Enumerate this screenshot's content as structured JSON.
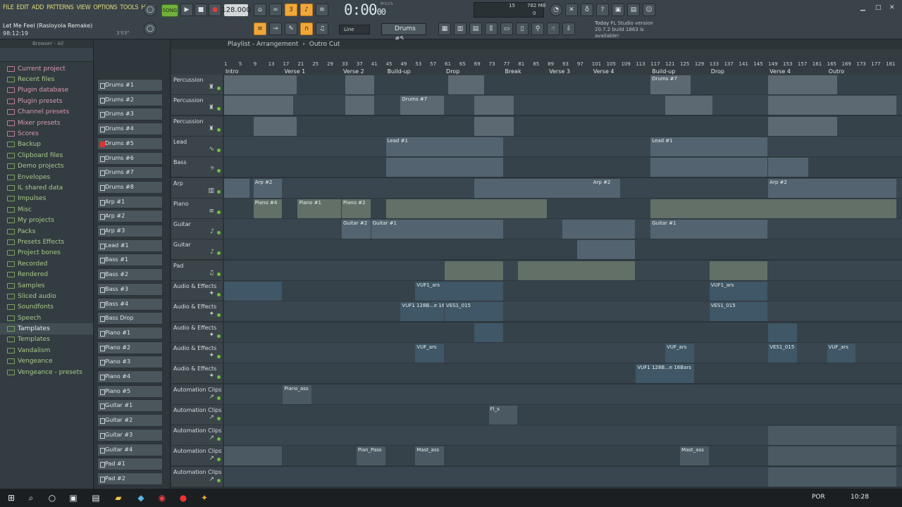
{
  "menu": [
    "FILE",
    "EDIT",
    "ADD",
    "PATTERNS",
    "VIEW",
    "OPTIONS",
    "TOOLS",
    "HELP"
  ],
  "project": {
    "title": "Let Me Feel (Rasloyola Remake)",
    "time": "98:12:19",
    "duration": "3'03\""
  },
  "transport": {
    "mode_label": "SONG",
    "tempo": "128.000",
    "time": "0:00",
    "time_sub": "00",
    "time_label": "M:S:CS"
  },
  "cpu": {
    "value": "15",
    "memory": "782 MB",
    "voices": "0"
  },
  "snap": "Line",
  "pattern": "Drums #5",
  "news": {
    "line1_label": "Today",
    "line1": "FL Studio version",
    "line2": "20.7.2 build 1863 is available!"
  },
  "browser": {
    "label": "Browser - All",
    "items": [
      {
        "label": "Current project",
        "style": "pink"
      },
      {
        "label": "Recent files",
        "style": "green"
      },
      {
        "label": "Plugin database",
        "style": "pink"
      },
      {
        "label": "Plugin presets",
        "style": "pink"
      },
      {
        "label": "Channel presets",
        "style": "pink"
      },
      {
        "label": "Mixer presets",
        "style": "pink"
      },
      {
        "label": "Scores",
        "style": "pink"
      },
      {
        "label": "Backup",
        "style": "green"
      },
      {
        "label": "Clipboard files",
        "style": "green"
      },
      {
        "label": "Demo projects",
        "style": "green"
      },
      {
        "label": "Envelopes",
        "style": "green"
      },
      {
        "label": "IL shared data",
        "style": "green"
      },
      {
        "label": "Impulses",
        "style": "green"
      },
      {
        "label": "Misc",
        "style": "green"
      },
      {
        "label": "My projects",
        "style": "green"
      },
      {
        "label": "Packs",
        "style": "green"
      },
      {
        "label": "Presets Effects",
        "style": "green"
      },
      {
        "label": "Project bones",
        "style": "green"
      },
      {
        "label": "Recorded",
        "style": "green"
      },
      {
        "label": "Rendered",
        "style": "green"
      },
      {
        "label": "Samples",
        "style": "green"
      },
      {
        "label": "Sliced audio",
        "style": "green"
      },
      {
        "label": "Soundfonts",
        "style": "green"
      },
      {
        "label": "Speech",
        "style": "green"
      },
      {
        "label": "Tamplates",
        "style": "sel"
      },
      {
        "label": "Templates",
        "style": "green"
      },
      {
        "label": "Vandalism",
        "style": "green"
      },
      {
        "label": "Vengeance",
        "style": "green"
      },
      {
        "label": "Vengeance - presets",
        "style": "green"
      }
    ]
  },
  "rack": {
    "items": [
      "Drums #1",
      "Drums #2",
      "Drums #3",
      "Drums #4",
      "Drums #5",
      "Drums #6",
      "Drums #7",
      "Drums #8",
      "Arp #1",
      "Arp #2",
      "Arp #3",
      "Lead #1",
      "Bass #1",
      "Bass #2",
      "Bass #3",
      "Bass #4",
      "Bass Drop",
      "Piano #1",
      "Piano #2",
      "Piano #3",
      "Piano #4",
      "Piano #5",
      "Guitar #1",
      "Guitar #2",
      "Guitar #3",
      "Guitar #4",
      "Pad #1",
      "Pad #2"
    ],
    "selected": 4
  },
  "playlist": {
    "title": "Playlist - Arrangement",
    "breadcrumb": "Outro Cut",
    "ruler": [
      "1",
      "5",
      "9",
      "13",
      "17",
      "21",
      "25",
      "29",
      "33",
      "37",
      "41",
      "45",
      "49",
      "53",
      "57",
      "61",
      "65",
      "69",
      "73",
      "77",
      "81",
      "85",
      "89",
      "93",
      "97",
      "101",
      "105",
      "109",
      "113",
      "117",
      "121",
      "125",
      "129",
      "133",
      "137",
      "141",
      "145",
      "149",
      "153",
      "157",
      "161",
      "165",
      "169",
      "173",
      "177",
      "181"
    ],
    "markers": [
      {
        "label": "Intro",
        "bar": 1
      },
      {
        "label": "Verse 1",
        "bar": 17
      },
      {
        "label": "Verse 2",
        "bar": 33
      },
      {
        "label": "Build-up",
        "bar": 45
      },
      {
        "label": "Drop",
        "bar": 61
      },
      {
        "label": "Break",
        "bar": 77
      },
      {
        "label": "Verse 3",
        "bar": 89
      },
      {
        "label": "Verse 4",
        "bar": 101
      },
      {
        "label": "Build-up",
        "bar": 117
      },
      {
        "label": "Drop",
        "bar": 133
      },
      {
        "label": "Verse 4",
        "bar": 149
      },
      {
        "label": "Outro",
        "bar": 165
      }
    ],
    "tracks": [
      {
        "name": "Percussion",
        "icon": "drum"
      },
      {
        "name": "Percussion",
        "icon": "drum"
      },
      {
        "name": "Percussion",
        "icon": "drum"
      },
      {
        "name": "Lead",
        "icon": "wave"
      },
      {
        "name": "Bass",
        "icon": "bass"
      },
      {
        "name": "Arp",
        "icon": "keys"
      },
      {
        "name": "Piano",
        "icon": "piano"
      },
      {
        "name": "Guitar",
        "icon": "guitar"
      },
      {
        "name": "Guitar",
        "icon": "guitar"
      },
      {
        "name": "Pad",
        "icon": "pad"
      },
      {
        "name": "Audio & Effects",
        "icon": "fx"
      },
      {
        "name": "Audio & Effects",
        "icon": "fx"
      },
      {
        "name": "Audio & Effects",
        "icon": "fx"
      },
      {
        "name": "Audio & Effects",
        "icon": "fx"
      },
      {
        "name": "Audio & Effects",
        "icon": "fx"
      },
      {
        "name": "Automation Clips",
        "icon": "auto"
      },
      {
        "name": "Automation Clips",
        "icon": "auto"
      },
      {
        "name": "Automation Clips",
        "icon": "auto"
      },
      {
        "name": "Automation Clips",
        "icon": "auto"
      },
      {
        "name": "Automation Clips",
        "icon": "auto"
      }
    ],
    "clip_labels": {
      "drums7": "Drums #7",
      "lead1": "Lead #1",
      "arp2": "Arp #2",
      "piano4": "Piano #4",
      "piano1": "Piano #1",
      "piano2": "Piano #2",
      "guitar1": "Guitar #1",
      "guitar2": "Guitar #2",
      "vuf1": "VUF1_ars",
      "ves1": "VES1_015",
      "vuf1288": "VUF1 128B...e 16Bars",
      "vuf": "VUF_ars",
      "piano_ass": "Piano_ass",
      "pian_pass": "Pian_Pass",
      "mast_ass": "Mast_ass",
      "fl": "Fl_s"
    }
  },
  "taskbar": {
    "lang": "POR",
    "clock": "10:28"
  },
  "colors": {
    "accent": "#f0a73a",
    "song_green": "#6fb13b",
    "menu_text": "#e0d97a"
  }
}
